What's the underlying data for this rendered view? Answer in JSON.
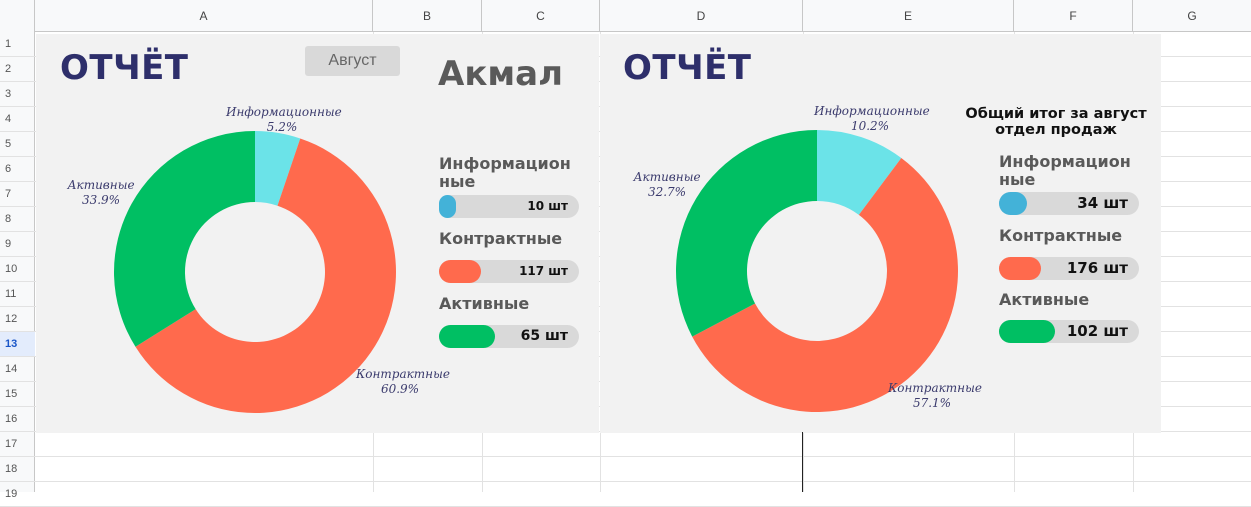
{
  "sheet": {
    "columns": [
      "A",
      "B",
      "C",
      "D",
      "E",
      "F",
      "G"
    ],
    "rows": [
      "1",
      "2",
      "3",
      "4",
      "5",
      "6",
      "7",
      "8",
      "9",
      "10",
      "11",
      "12",
      "13",
      "14",
      "15",
      "16",
      "17",
      "18",
      "19"
    ],
    "active_row": "13"
  },
  "left": {
    "title": "ОТЧЁТ",
    "month_button": "Август",
    "person": "Акмал",
    "categories": [
      {
        "label": "Информацион\nные",
        "value_text": "10 шт",
        "fill": 0.12,
        "color": "#43b2d8"
      },
      {
        "label": "Контрактные",
        "value_text": "117 шт",
        "fill": 0.3,
        "color": "#ff6a4d"
      },
      {
        "label": "Активные",
        "value_text": "65 шт",
        "fill": 0.4,
        "color": "#00bf63"
      }
    ]
  },
  "right": {
    "title": "ОТЧЁТ",
    "summary": "Общий итог за август\nотдел продаж",
    "categories": [
      {
        "label": "Информацион\nные",
        "value_text": "34 шт",
        "fill": 0.2,
        "color": "#43b2d8"
      },
      {
        "label": "Контрактные",
        "value_text": "176 шт",
        "fill": 0.3,
        "color": "#ff6a4d"
      },
      {
        "label": "Активные",
        "value_text": "102 шт",
        "fill": 0.4,
        "color": "#00bf63"
      }
    ]
  },
  "chart_data": [
    {
      "type": "pie",
      "title": "",
      "categories": [
        "Информационные",
        "Контрактные",
        "Активные"
      ],
      "values": [
        5.2,
        60.9,
        33.9
      ],
      "value_labels": [
        "5.2%",
        "60.9%",
        "33.9%"
      ],
      "colors": [
        "#6be3e8",
        "#ff6a4d",
        "#00bf63"
      ]
    },
    {
      "type": "pie",
      "title": "",
      "categories": [
        "Информационные",
        "Контрактные",
        "Активные"
      ],
      "values": [
        10.2,
        57.1,
        32.7
      ],
      "value_labels": [
        "10.2%",
        "57.1%",
        "32.7%"
      ],
      "colors": [
        "#6be3e8",
        "#ff6a4d",
        "#00bf63"
      ]
    }
  ]
}
